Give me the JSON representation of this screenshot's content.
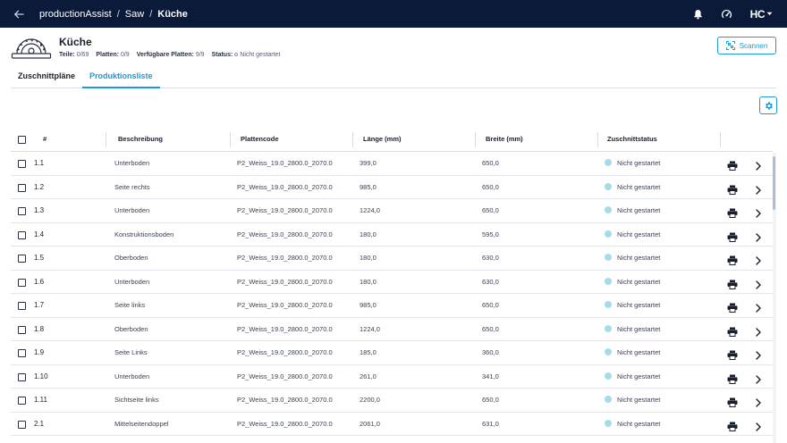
{
  "topbar": {
    "breadcrumbs": [
      "productionAssist",
      "Saw",
      "Küche"
    ],
    "separator": "/",
    "logo_text": "HC",
    "icons": [
      "back-arrow-icon",
      "bell-icon",
      "speedometer-icon",
      "chevron-down-icon"
    ]
  },
  "header": {
    "title": "Küche",
    "teile_label": "Teile:",
    "teile_value": "0/69",
    "platten_label": "Platten:",
    "platten_value": "0/9",
    "verf_label": "Verfügbare Platten:",
    "verf_value": "9/9",
    "status_label": "Status:",
    "status_value": "Nicht gestartet",
    "scan_label": "Scannen"
  },
  "tabs": [
    {
      "label": "Zuschnittpläne",
      "active": false
    },
    {
      "label": "Produktionsliste",
      "active": true
    }
  ],
  "table": {
    "columns": {
      "index": "#",
      "beschreibung": "Beschreibung",
      "plattencode": "Plattencode",
      "laenge": "Länge (mm)",
      "breite": "Breite (mm)",
      "status": "Zuschnittstatus"
    },
    "status_color": "#a8dbe8",
    "rows": [
      {
        "index": "1.1",
        "beschreibung": "Unterboden",
        "plattencode": "P2_Weiss_19.0_2800.0_2070.0",
        "laenge": "399,0",
        "breite": "650,0",
        "status": "Nicht gestartet"
      },
      {
        "index": "1.2",
        "beschreibung": "Seite rechts",
        "plattencode": "P2_Weiss_19.0_2800.0_2070.0",
        "laenge": "985,0",
        "breite": "650,0",
        "status": "Nicht gestartet"
      },
      {
        "index": "1.3",
        "beschreibung": "Unterboden",
        "plattencode": "P2_Weiss_19.0_2800.0_2070.0",
        "laenge": "1224,0",
        "breite": "650,0",
        "status": "Nicht gestartet"
      },
      {
        "index": "1.4",
        "beschreibung": "Konstruktionsboden",
        "plattencode": "P2_Weiss_19.0_2800.0_2070.0",
        "laenge": "180,0",
        "breite": "595,0",
        "status": "Nicht gestartet"
      },
      {
        "index": "1.5",
        "beschreibung": "Oberboden",
        "plattencode": "P2_Weiss_19.0_2800.0_2070.0",
        "laenge": "180,0",
        "breite": "630,0",
        "status": "Nicht gestartet"
      },
      {
        "index": "1.6",
        "beschreibung": "Unterboden",
        "plattencode": "P2_Weiss_19.0_2800.0_2070.0",
        "laenge": "180,0",
        "breite": "630,0",
        "status": "Nicht gestartet"
      },
      {
        "index": "1.7",
        "beschreibung": "Seite links",
        "plattencode": "P2_Weiss_19.0_2800.0_2070.0",
        "laenge": "985,0",
        "breite": "650,0",
        "status": "Nicht gestartet"
      },
      {
        "index": "1.8",
        "beschreibung": "Oberboden",
        "plattencode": "P2_Weiss_19.0_2800.0_2070.0",
        "laenge": "1224,0",
        "breite": "650,0",
        "status": "Nicht gestartet"
      },
      {
        "index": "1.9",
        "beschreibung": "Seite Links",
        "plattencode": "P2_Weiss_19.0_2800.0_2070.0",
        "laenge": "185,0",
        "breite": "360,0",
        "status": "Nicht gestartet"
      },
      {
        "index": "1.10",
        "beschreibung": "Unterboden",
        "plattencode": "P2_Weiss_19.0_2800.0_2070.0",
        "laenge": "261,0",
        "breite": "341,0",
        "status": "Nicht gestartet"
      },
      {
        "index": "1.11",
        "beschreibung": "Sichtseite links",
        "plattencode": "P2_Weiss_19.0_2800.0_2070.0",
        "laenge": "2200,0",
        "breite": "650,0",
        "status": "Nicht gestartet"
      },
      {
        "index": "2.1",
        "beschreibung": "Mittelseitendoppel",
        "plattencode": "P2_Weiss_19.0_2800.0_2070.0",
        "laenge": "2061,0",
        "breite": "631,0",
        "status": "Nicht gestartet"
      }
    ]
  },
  "colors": {
    "topbar": "#0c1a3a",
    "accent": "#1a9bd7"
  }
}
